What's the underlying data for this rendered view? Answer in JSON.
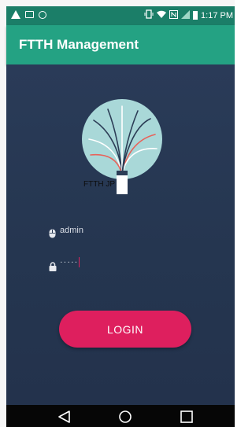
{
  "status_bar": {
    "time": "1:17 PM",
    "icons": [
      "warning-icon",
      "image-icon",
      "sync-icon",
      "vibrate-icon",
      "wifi-icon",
      "nfc-icon",
      "signal-icon",
      "battery-icon"
    ]
  },
  "app_bar": {
    "title": "FTTH Management"
  },
  "logo": {
    "label": "FTTH JP"
  },
  "login_form": {
    "username_value": "admin",
    "password_value": "·····",
    "login_label": "LOGIN"
  },
  "nav_bar": {
    "icons": [
      "back-icon",
      "home-icon",
      "recents-icon"
    ]
  },
  "colors": {
    "status_bar": "#1b7e68",
    "app_bar": "#24a283",
    "background": "#253650",
    "accent": "#de1f5e"
  }
}
